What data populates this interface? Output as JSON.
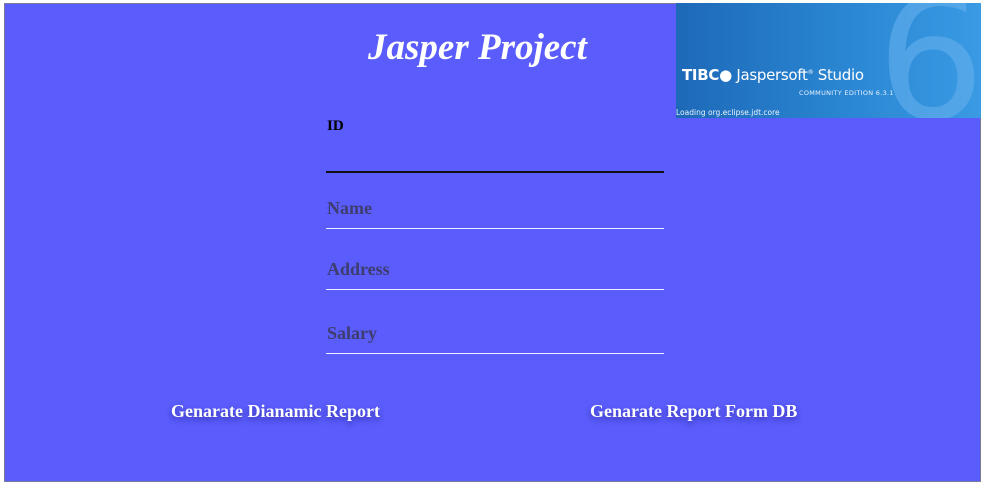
{
  "title": "Jasper Project",
  "splash": {
    "brand_prefix": "TIBC",
    "brand_name": "Jaspersoft",
    "brand_product": "Studio",
    "edition": "COMMUNITY EDITION 6.3.1",
    "status": "Loading org.eclipse.jdt.core",
    "version_glyph": "6"
  },
  "form": {
    "id_label": "ID",
    "name_placeholder": "Name",
    "address_placeholder": "Address",
    "salary_placeholder": "Salary"
  },
  "buttons": {
    "dynamic_report": "Genarate Dianamic Report",
    "db_report": "Genarate Report Form DB"
  },
  "colors": {
    "background": "#5a5cfb",
    "text": "#ffffff",
    "splash_blue": "#2a86d2"
  }
}
